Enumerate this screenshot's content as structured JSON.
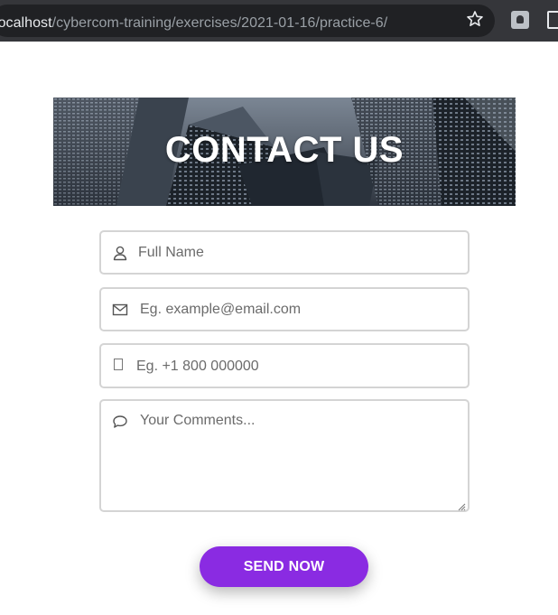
{
  "browser": {
    "url_host": "localhost",
    "url_path": "/cybercom-training/exercises/2021-01-16/practice-6/",
    "icons": [
      "star-icon",
      "extension-icon",
      "window-icon"
    ]
  },
  "banner": {
    "title": "CONTACT US"
  },
  "form": {
    "name_placeholder": "Full Name",
    "email_placeholder": "Eg. example@email.com",
    "phone_placeholder": "Eg. +1 800 000000",
    "comments_placeholder": "Your Comments...",
    "icons": [
      "user-icon",
      "envelope-icon",
      "phone-glyph-icon",
      "comment-icon"
    ]
  },
  "button": {
    "send_label": "SEND NOW",
    "color": "#8a2be2"
  }
}
